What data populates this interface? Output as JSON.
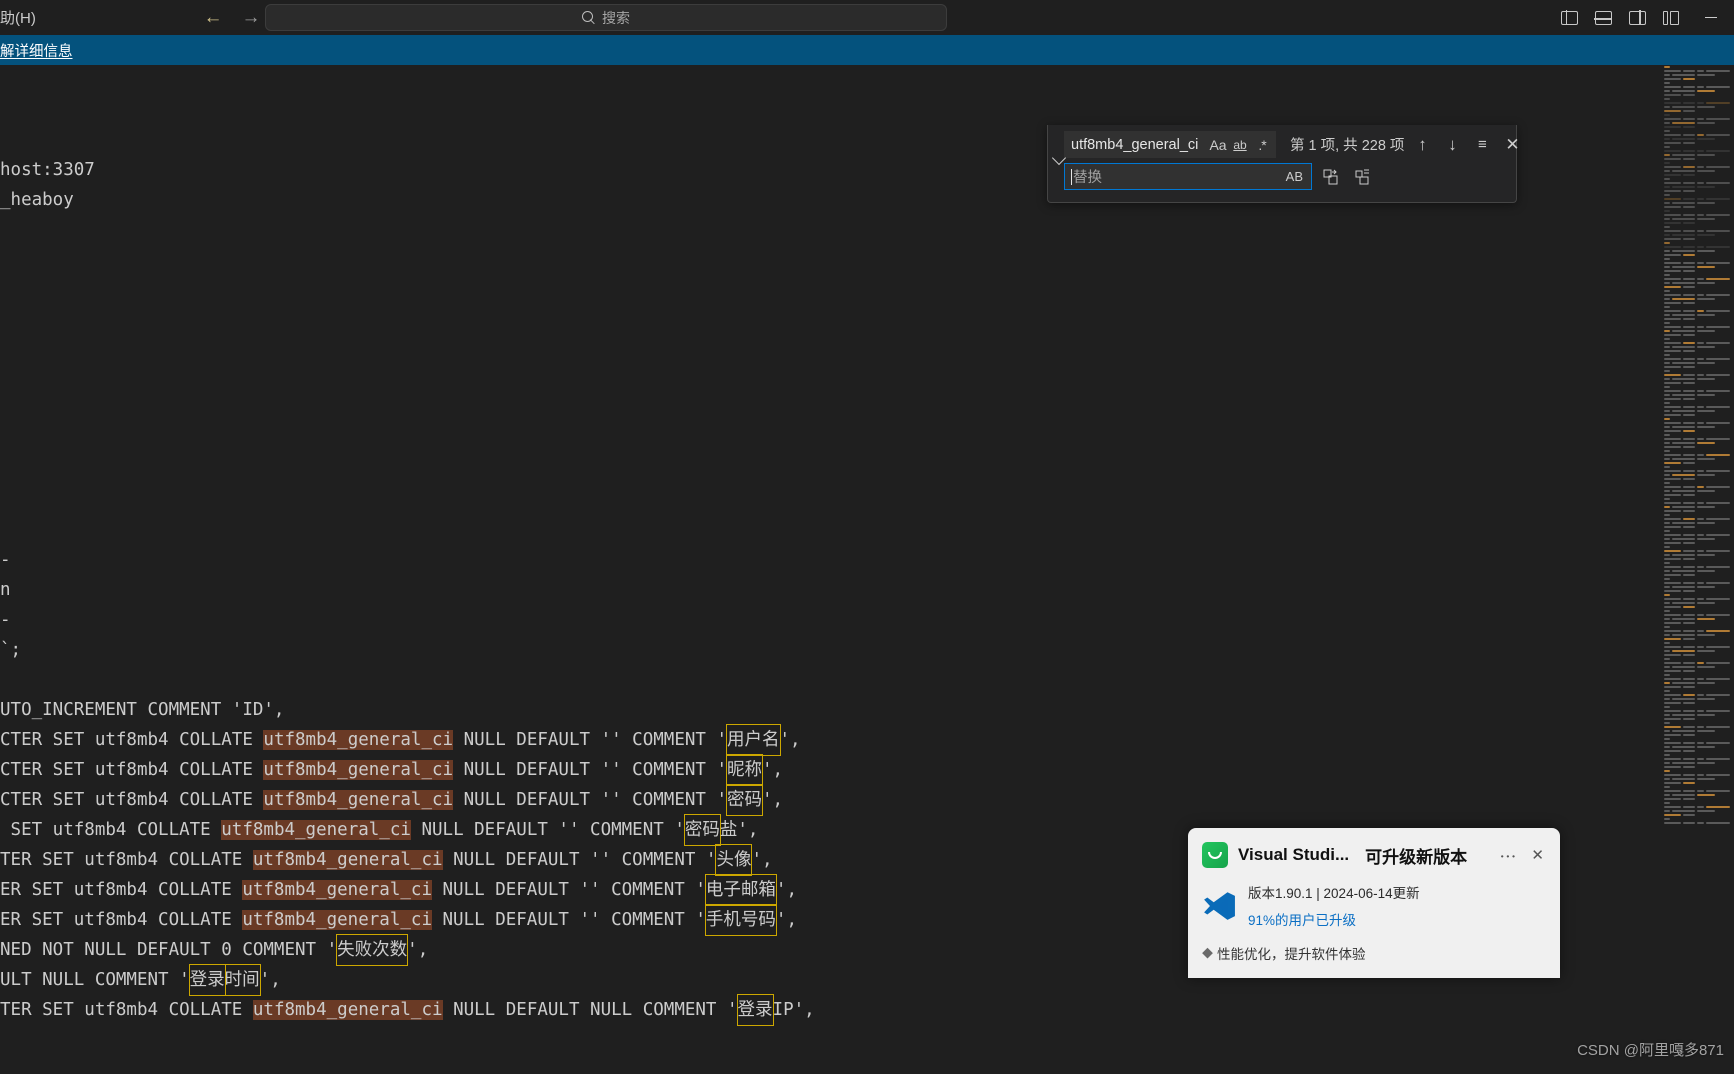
{
  "titlebar": {
    "menu_tail": "助(H)",
    "back_icon": "arrow-left-icon",
    "forward_icon": "arrow-right-icon",
    "search_placeholder": "搜索",
    "search_icon": "search-icon",
    "layout_buttons": [
      {
        "name": "toggle-primary-sidebar",
        "icon": "layout-left-icon"
      },
      {
        "name": "toggle-panel",
        "icon": "layout-bottom-icon"
      },
      {
        "name": "toggle-secondary-sidebar",
        "icon": "layout-right-icon"
      },
      {
        "name": "customize-layout",
        "icon": "layout-customize-icon"
      }
    ],
    "minimize_label": "—"
  },
  "banner": {
    "link_text": "解详细信息"
  },
  "find_widget": {
    "search_value": "utf8mb4_general_ci",
    "match_case_label": "Aa",
    "whole_word_label": "ab",
    "regex_label": ".*",
    "match_count": "第 1 项, 共 228 项",
    "previous_icon": "arrow-up-icon",
    "next_icon": "arrow-down-icon",
    "find_in_selection_icon": "find-in-selection-icon",
    "close_icon": "close-icon",
    "toggle_replace_icon": "chevron-down-icon",
    "replace_placeholder": "替换",
    "replace_value": "",
    "preserve_case_label": "AB",
    "replace_one_icon": "replace-icon",
    "replace_all_icon": "replace-all-icon"
  },
  "editor": {
    "lines": [
      {
        "id": "l1",
        "text": ""
      },
      {
        "id": "l2",
        "text": ""
      },
      {
        "id": "l3",
        "text": ""
      },
      {
        "id": "l4",
        "text": "host:3307"
      },
      {
        "id": "l5",
        "text": "_heaboy"
      },
      {
        "id": "l6",
        "text": ""
      },
      {
        "id": "l7",
        "text": ""
      },
      {
        "id": "l8",
        "text": ""
      },
      {
        "id": "l9",
        "text": ""
      },
      {
        "id": "l10",
        "text": ""
      },
      {
        "id": "l11",
        "text": ""
      },
      {
        "id": "l12",
        "text": ""
      },
      {
        "id": "l13",
        "text": ""
      },
      {
        "id": "l14",
        "text": ""
      },
      {
        "id": "l15",
        "text": ""
      },
      {
        "id": "l16",
        "text": ""
      },
      {
        "id": "l17",
        "text": "-"
      },
      {
        "id": "l18",
        "text": "n"
      },
      {
        "id": "l19",
        "text": "-"
      },
      {
        "id": "l20",
        "text": "`;"
      },
      {
        "id": "l21",
        "text": ""
      },
      {
        "id": "l22",
        "text": "UTO_INCREMENT COMMENT 'ID',"
      },
      {
        "id": "l23",
        "text": "CTER SET utf8mb4 COLLATE utf8mb4_general_ci NULL DEFAULT '' COMMENT '用户名',"
      },
      {
        "id": "l24",
        "text": "CTER SET utf8mb4 COLLATE utf8mb4_general_ci NULL DEFAULT '' COMMENT '昵称',"
      },
      {
        "id": "l25",
        "text": "CTER SET utf8mb4 COLLATE utf8mb4_general_ci NULL DEFAULT '' COMMENT '密码',"
      },
      {
        "id": "l26",
        "text": " SET utf8mb4 COLLATE utf8mb4_general_ci NULL DEFAULT '' COMMENT '密码盐',"
      },
      {
        "id": "l27",
        "text": "TER SET utf8mb4 COLLATE utf8mb4_general_ci NULL DEFAULT '' COMMENT '头像',"
      },
      {
        "id": "l28",
        "text": "ER SET utf8mb4 COLLATE utf8mb4_general_ci NULL DEFAULT '' COMMENT '电子邮箱',"
      },
      {
        "id": "l29",
        "text": "ER SET utf8mb4 COLLATE utf8mb4_general_ci NULL DEFAULT '' COMMENT '手机号码',"
      },
      {
        "id": "l30",
        "text": "NED NOT NULL DEFAULT 0 COMMENT '失败次数',"
      },
      {
        "id": "l31",
        "text": "ULT NULL COMMENT '登录时间',"
      },
      {
        "id": "l32",
        "text": "TER SET utf8mb4 COLLATE utf8mb4_general_ci NULL DEFAULT NULL COMMENT '登录IP',"
      }
    ],
    "highlight_term": "utf8mb4_general_ci",
    "unicode_boxed_comments": [
      "用户名",
      "昵称",
      "密码",
      "密码盐",
      "头像",
      "电子邮箱",
      "手机号码",
      "失败次数",
      "登录时间",
      "登录"
    ]
  },
  "toast": {
    "app_name": "Visual Studi...",
    "headline": "可升级新版本",
    "version_line": "版本1.90.1 | 2024-06-14更新",
    "upgrade_pct": "91%的用户已升级",
    "bullet": "性能优化，提升软件体验",
    "more_icon": "more-horizontal-icon",
    "close_icon": "close-icon",
    "logo_icon": "app-store-icon",
    "vs_icon": "visual-studio-code-icon"
  },
  "watermark": {
    "text": "CSDN @阿里嘎多871"
  },
  "colors": {
    "banner_blue": "#04527d",
    "editor_bg": "#1f1f1f",
    "match_highlight": "#6a3a25",
    "unicode_box": "#cca700",
    "focus_border": "#0078d4"
  }
}
